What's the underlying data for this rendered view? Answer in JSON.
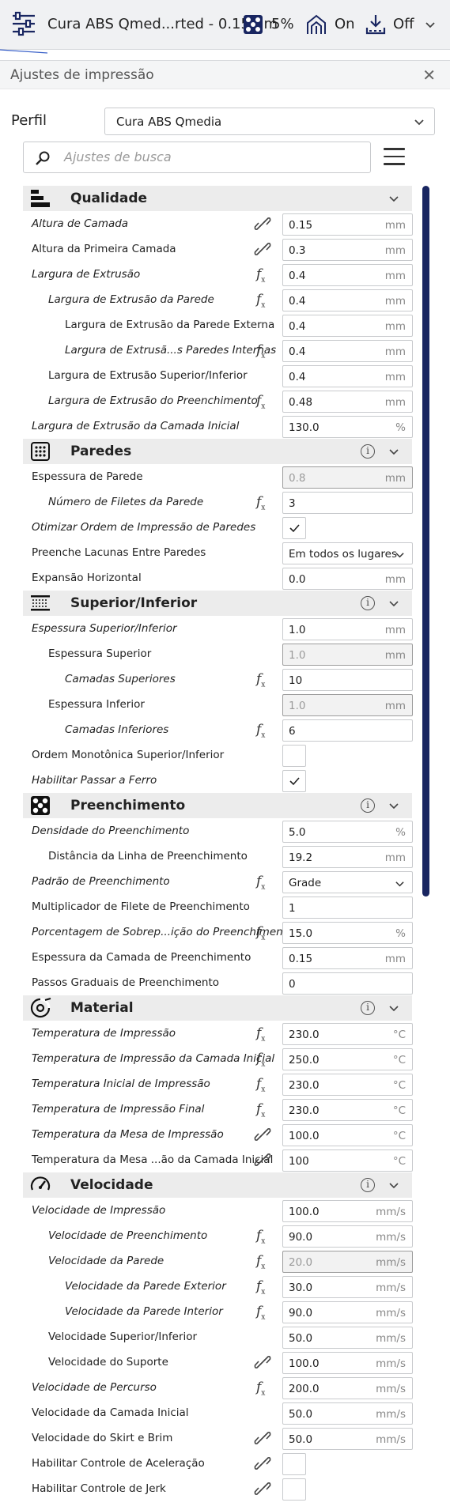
{
  "topbar": {
    "printer_name": "Cura ABS Qmed...rted - 0.15mm",
    "infill": "5%",
    "support": "On",
    "adhesion": "Off"
  },
  "panel": {
    "title": "Ajustes de impressão",
    "profile_label": "Perfil",
    "profile_value": "Cura ABS Qmedia",
    "search_placeholder": "Ajustes de busca"
  },
  "colors": {
    "accent": "#192661",
    "category_bg": "#ececec"
  },
  "rows": [
    {
      "type": "cat",
      "label": "Qualidade",
      "icon": "quality-icon",
      "info": false
    },
    {
      "label": "Altura de Camada",
      "italic": true,
      "indent": 0,
      "mark": "link",
      "value": "0.15",
      "unit": "mm"
    },
    {
      "label": "Altura da Primeira Camada",
      "italic": false,
      "indent": 0,
      "mark": "link",
      "value": "0.3",
      "unit": "mm"
    },
    {
      "label": "Largura de Extrusão",
      "italic": true,
      "indent": 0,
      "mark": "fx",
      "value": "0.4",
      "unit": "mm"
    },
    {
      "label": "Largura de Extrusão da Parede",
      "italic": true,
      "indent": 1,
      "mark": "fx",
      "value": "0.4",
      "unit": "mm"
    },
    {
      "label": "Largura de Extrusão da Parede Externa",
      "italic": false,
      "indent": 2,
      "mark": "",
      "value": "0.4",
      "unit": "mm"
    },
    {
      "label": "Largura de Extrusã...s Paredes Internas",
      "italic": true,
      "indent": 2,
      "mark": "fx",
      "value": "0.4",
      "unit": "mm"
    },
    {
      "label": "Largura de Extrusão Superior/Inferior",
      "italic": false,
      "indent": 1,
      "mark": "",
      "value": "0.4",
      "unit": "mm"
    },
    {
      "label": "Largura de Extrusão do Preenchimento",
      "italic": true,
      "indent": 1,
      "mark": "fx",
      "value": "0.48",
      "unit": "mm"
    },
    {
      "label": "Largura de Extrusão da Camada Inicial",
      "italic": true,
      "indent": 0,
      "mark": "",
      "value": "130.0",
      "unit": "%"
    },
    {
      "type": "cat",
      "label": "Paredes",
      "icon": "walls-icon",
      "info": true
    },
    {
      "label": "Espessura de Parede",
      "italic": false,
      "indent": 0,
      "mark": "",
      "value": "0.8",
      "unit": "mm",
      "disabled": true
    },
    {
      "label": "Número de Filetes da Parede",
      "italic": true,
      "indent": 1,
      "mark": "fx",
      "value": "3",
      "unit": ""
    },
    {
      "label": "Otimizar Ordem de Impressão de Paredes",
      "italic": true,
      "indent": 0,
      "mark": "",
      "control": "check",
      "checked": true
    },
    {
      "label": "Preenche Lacunas Entre Paredes",
      "italic": false,
      "indent": 0,
      "mark": "",
      "control": "dropdown",
      "value": "Em todos os lugares"
    },
    {
      "label": "Expansão Horizontal",
      "italic": false,
      "indent": 0,
      "mark": "",
      "value": "0.0",
      "unit": "mm"
    },
    {
      "type": "cat",
      "label": "Superior/Inferior",
      "icon": "top-bottom-icon",
      "info": true
    },
    {
      "label": "Espessura Superior/Inferior",
      "italic": true,
      "indent": 0,
      "mark": "",
      "value": "1.0",
      "unit": "mm"
    },
    {
      "label": "Espessura Superior",
      "italic": false,
      "indent": 1,
      "mark": "",
      "value": "1.0",
      "unit": "mm",
      "disabled": true
    },
    {
      "label": "Camadas Superiores",
      "italic": true,
      "indent": 2,
      "mark": "fx",
      "value": "10",
      "unit": ""
    },
    {
      "label": "Espessura Inferior",
      "italic": false,
      "indent": 1,
      "mark": "",
      "value": "1.0",
      "unit": "mm",
      "disabled": true
    },
    {
      "label": "Camadas Inferiores",
      "italic": true,
      "indent": 2,
      "mark": "fx",
      "value": "6",
      "unit": ""
    },
    {
      "label": "Ordem Monotônica Superior/Inferior",
      "italic": false,
      "indent": 0,
      "mark": "",
      "control": "check",
      "checked": false
    },
    {
      "label": "Habilitar Passar a Ferro",
      "italic": true,
      "indent": 0,
      "mark": "",
      "control": "check",
      "checked": true
    },
    {
      "type": "cat",
      "label": "Preenchimento",
      "icon": "infill-icon",
      "info": true
    },
    {
      "label": "Densidade do Preenchimento",
      "italic": true,
      "indent": 0,
      "mark": "",
      "value": "5.0",
      "unit": "%"
    },
    {
      "label": "Distância da Linha de Preenchimento",
      "italic": false,
      "indent": 1,
      "mark": "",
      "value": "19.2",
      "unit": "mm"
    },
    {
      "label": "Padrão de Preenchimento",
      "italic": true,
      "indent": 0,
      "mark": "fx",
      "control": "dropdown",
      "value": "Grade"
    },
    {
      "label": "Multiplicador de Filete de Preenchimento",
      "italic": false,
      "indent": 0,
      "mark": "",
      "value": "1",
      "unit": ""
    },
    {
      "label": "Porcentagem de Sobrep...ição do Preenchimento",
      "italic": true,
      "indent": 0,
      "mark": "fx",
      "value": "15.0",
      "unit": "%"
    },
    {
      "label": "Espessura da Camada de Preenchimento",
      "italic": false,
      "indent": 0,
      "mark": "",
      "value": "0.15",
      "unit": "mm"
    },
    {
      "label": "Passos Graduais de Preenchimento",
      "italic": false,
      "indent": 0,
      "mark": "",
      "value": "0",
      "unit": ""
    },
    {
      "type": "cat",
      "label": "Material",
      "icon": "material-icon",
      "info": true
    },
    {
      "label": "Temperatura de Impressão",
      "italic": true,
      "indent": 0,
      "mark": "fx",
      "value": "230.0",
      "unit": "°C"
    },
    {
      "label": "Temperatura de Impressão da Camada Inicial",
      "italic": true,
      "indent": 0,
      "mark": "fx",
      "value": "250.0",
      "unit": "°C"
    },
    {
      "label": "Temperatura Inicial de Impressão",
      "italic": true,
      "indent": 0,
      "mark": "fx",
      "value": "230.0",
      "unit": "°C"
    },
    {
      "label": "Temperatura de Impressão Final",
      "italic": true,
      "indent": 0,
      "mark": "fx",
      "value": "230.0",
      "unit": "°C"
    },
    {
      "label": "Temperatura da Mesa de Impressão",
      "italic": true,
      "indent": 0,
      "mark": "link",
      "value": "100.0",
      "unit": "°C"
    },
    {
      "label": "Temperatura da Mesa ...ão da Camada Inicial",
      "italic": false,
      "indent": 0,
      "mark": "link",
      "value": "100",
      "unit": "°C"
    },
    {
      "type": "cat",
      "label": "Velocidade",
      "icon": "speed-icon",
      "info": true
    },
    {
      "label": "Velocidade de Impressão",
      "italic": true,
      "indent": 0,
      "mark": "",
      "value": "100.0",
      "unit": "mm/s"
    },
    {
      "label": "Velocidade de Preenchimento",
      "italic": true,
      "indent": 1,
      "mark": "fx",
      "value": "90.0",
      "unit": "mm/s"
    },
    {
      "label": "Velocidade da Parede",
      "italic": true,
      "indent": 1,
      "mark": "fx",
      "value": "20.0",
      "unit": "mm/s",
      "disabled": true
    },
    {
      "label": "Velocidade da Parede Exterior",
      "italic": true,
      "indent": 2,
      "mark": "fx",
      "value": "30.0",
      "unit": "mm/s"
    },
    {
      "label": "Velocidade da Parede Interior",
      "italic": true,
      "indent": 2,
      "mark": "fx",
      "value": "90.0",
      "unit": "mm/s"
    },
    {
      "label": "Velocidade Superior/Inferior",
      "italic": false,
      "indent": 1,
      "mark": "",
      "value": "50.0",
      "unit": "mm/s"
    },
    {
      "label": "Velocidade do Suporte",
      "italic": false,
      "indent": 1,
      "mark": "link",
      "value": "100.0",
      "unit": "mm/s"
    },
    {
      "label": "Velocidade de Percurso",
      "italic": true,
      "indent": 0,
      "mark": "fx",
      "value": "200.0",
      "unit": "mm/s"
    },
    {
      "label": "Velocidade da Camada Inicial",
      "italic": false,
      "indent": 0,
      "mark": "",
      "value": "50.0",
      "unit": "mm/s"
    },
    {
      "label": "Velocidade do Skirt e Brim",
      "italic": false,
      "indent": 0,
      "mark": "link",
      "value": "50.0",
      "unit": "mm/s"
    },
    {
      "label": "Habilitar Controle de Aceleração",
      "italic": false,
      "indent": 0,
      "mark": "link",
      "control": "check",
      "checked": false
    },
    {
      "label": "Habilitar Controle de Jerk",
      "italic": false,
      "indent": 0,
      "mark": "link",
      "control": "check",
      "checked": false
    }
  ]
}
